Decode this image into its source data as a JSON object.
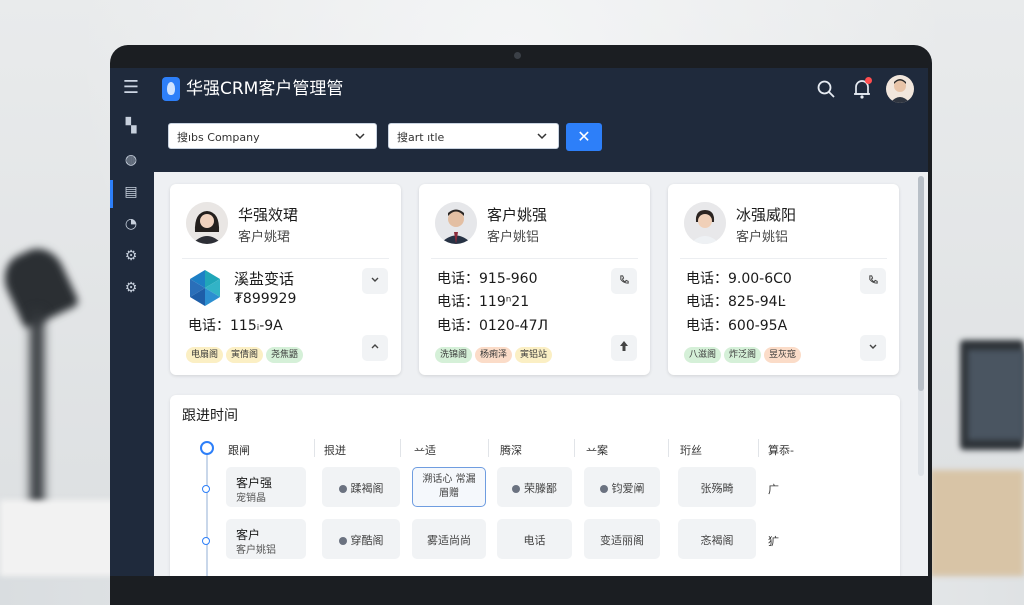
{
  "app": {
    "title": "华强CRM客户管理管"
  },
  "filters": {
    "company_placeholder": "搜ıbs Company",
    "title_placeholder": "搜art ıtle",
    "clear_icon": "close-icon"
  },
  "cards": [
    {
      "name": "华强效珺",
      "role": "客户姚珺",
      "company": "溪盐变话",
      "code": "₮899929",
      "phone": "电话：115ᵢ-9A",
      "tags": [
        "电扇阁",
        "寅倩阁",
        "尧焦鼯"
      ],
      "action_top": "chevron-down-icon",
      "action_bottom": "chevron-up-icon"
    },
    {
      "name": "客户姚强",
      "role": "客户姚铝",
      "line1": "电话：915-960",
      "line2": "电话：119ⁿ21",
      "line3": "电话：0120-47Л",
      "tags": [
        "洗锦阁",
        "杨痢泽",
        "寅铝站"
      ],
      "action_top": "phone-icon",
      "action_bottom": "arrow-up-icon"
    },
    {
      "name": "冰强威阳",
      "role": "客户姚铝",
      "line1": "电话：9.00-6C0",
      "line2": "电话：825-94Ŀ",
      "line3": "电话：600-95A",
      "tags": [
        "八滋阁",
        "炸泛阁",
        "昱灰寇"
      ],
      "action_top": "phone-icon",
      "action_bottom": "chevron-down-icon"
    }
  ],
  "followup": {
    "title": "跟进时间",
    "columns": [
      "跟闸",
      "拫迸",
      "䒑适",
      "腾深",
      "䒑案",
      "珩丝",
      "算忝-"
    ],
    "rows": [
      {
        "lead_t1": "客户强",
        "lead_t2": "宠销晶",
        "cells": [
          "蹂褐阁",
          "溯话心 常漏眉赠",
          "荣滕鄙",
          "钧爱阐",
          "张殇畸"
        ],
        "end": "广"
      },
      {
        "lead_t1": "客户",
        "lead_t2": "客户姚铝",
        "cells": [
          "穿酷阁",
          "雾适尚尚",
          "电话",
          "变适丽阁",
          "忞褐阁"
        ],
        "end": "犷"
      }
    ]
  }
}
